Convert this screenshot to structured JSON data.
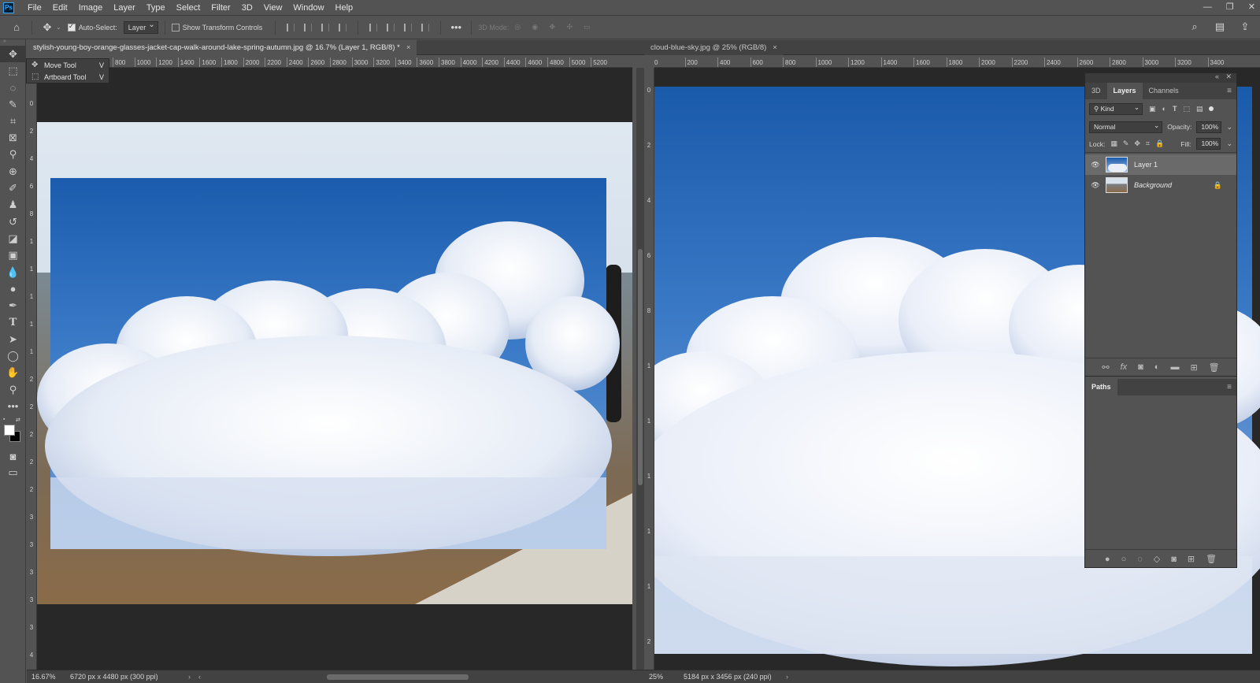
{
  "menu": {
    "logo": "Ps",
    "items": [
      "File",
      "Edit",
      "Image",
      "Layer",
      "Type",
      "Select",
      "Filter",
      "3D",
      "View",
      "Window",
      "Help"
    ],
    "window_controls": [
      "—",
      "❐",
      "✕"
    ]
  },
  "options": {
    "auto_select_label": "Auto-Select:",
    "auto_select_checked": true,
    "auto_select_target": "Layer",
    "show_transform_label": "Show Transform Controls",
    "mode_3d_label": "3D Mode:"
  },
  "tool_flyout": {
    "items": [
      {
        "label": "Move Tool",
        "key": "V"
      },
      {
        "label": "Artboard Tool",
        "key": "V"
      }
    ]
  },
  "doc_left": {
    "tab_title": "stylish-young-boy-orange-glasses-jacket-cap-walk-around-lake-spring-autumn.jpg @ 16.7% (Layer 1, RGB/8) *",
    "zoom": "16.67%",
    "size_info": "6720 px x 4480 px (300 ppi)",
    "ruler_ticks": [
      "800",
      "1000",
      "1200",
      "1400",
      "1600",
      "1800",
      "2000",
      "2200",
      "2400",
      "2600",
      "2800",
      "3000",
      "3200",
      "3400",
      "3600",
      "3800",
      "4000",
      "4200",
      "4400",
      "4600",
      "4800",
      "5000",
      "5200"
    ],
    "vruler_ticks": [
      "0",
      "0",
      "2",
      "4",
      "6",
      "8",
      "1",
      "1",
      "1",
      "1",
      "1",
      "2",
      "2",
      "2",
      "2",
      "2",
      "3",
      "3",
      "3",
      "3",
      "3",
      "4"
    ]
  },
  "doc_right": {
    "tab_title": "cloud-blue-sky.jpg @ 25% (RGB/8)",
    "zoom": "25%",
    "size_info": "5184 px x 3456 px (240 ppi)",
    "ruler_ticks": [
      "0",
      "200",
      "400",
      "600",
      "800",
      "1000",
      "1200",
      "1400",
      "1600",
      "1800",
      "2000",
      "2200",
      "2400",
      "2600",
      "2800",
      "3000",
      "3200",
      "3400"
    ],
    "vruler_ticks": [
      "0",
      "2",
      "4",
      "6",
      "8",
      "1",
      "1",
      "1",
      "1",
      "1",
      "2"
    ]
  },
  "layers_panel": {
    "tabs": [
      "3D",
      "Layers",
      "Channels"
    ],
    "active_tab": "Layers",
    "filter_kind": "Kind",
    "blend_mode": "Normal",
    "opacity_label": "Opacity:",
    "opacity_value": "100%",
    "lock_label": "Lock:",
    "fill_label": "Fill:",
    "fill_value": "100%",
    "layers": [
      {
        "name": "Layer 1",
        "selected": true,
        "locked": false
      },
      {
        "name": "Background",
        "selected": false,
        "locked": true
      }
    ],
    "paths_tab": "Paths"
  },
  "colors": {
    "ui_bg": "#535353",
    "panel_dark": "#424242",
    "canvas_bg": "#282828",
    "sky_top": "#1b5cae",
    "sky_mid": "#4a86c9"
  }
}
